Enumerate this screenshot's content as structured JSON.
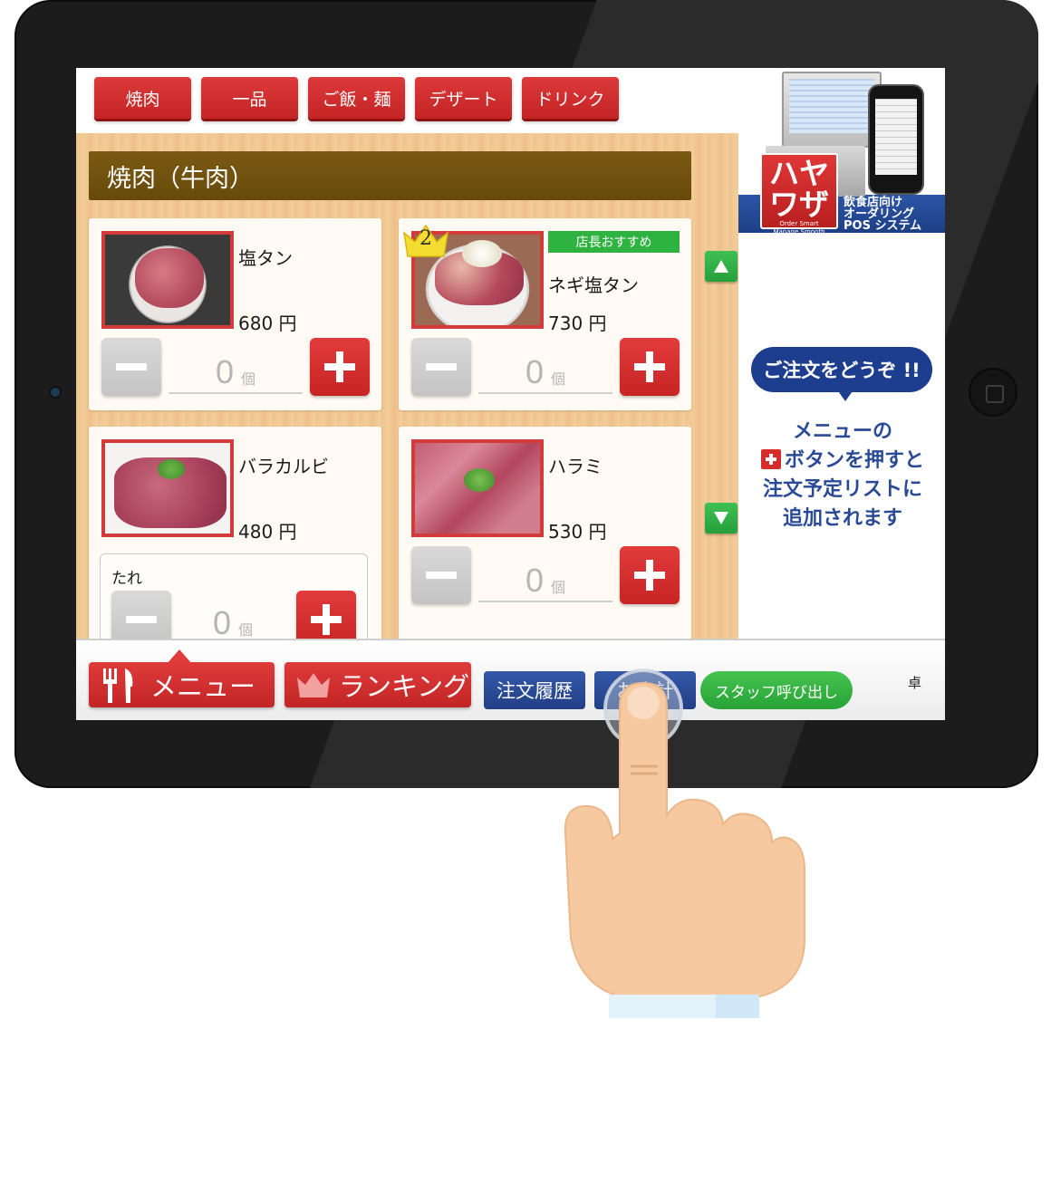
{
  "categories": [
    "焼肉",
    "一品",
    "ご飯・麺",
    "デザート",
    "ドリンク"
  ],
  "section_title": "焼肉（牛肉）",
  "items": [
    {
      "name": "塩タン",
      "price": "680 円",
      "qty": "0",
      "unit": "個"
    },
    {
      "name": "ネギ塩タン",
      "price": "730 円",
      "qty": "0",
      "unit": "個",
      "badge": "店長おすすめ",
      "rank": "2"
    },
    {
      "name": "バラカルビ",
      "price": "480 円",
      "qty": "0",
      "unit": "個",
      "option_label": "たれ"
    },
    {
      "name": "ハラミ",
      "price": "530 円",
      "qty": "0",
      "unit": "個"
    }
  ],
  "ad": {
    "logo_line1": "ハヤ",
    "logo_line2": "ワザ",
    "logo_small1": "Order Smart",
    "logo_small2": "Manage Smooth",
    "tag_line1": "飲食店向け",
    "tag_line2": "オーダリング",
    "tag_line3": "POS システム"
  },
  "prompt": {
    "bubble": "ご注文をどうぞ !!",
    "line1": "メニューの",
    "line2": "ボタンを押すと",
    "line3": "注文予定リストに",
    "line4": "追加されます"
  },
  "bottom": {
    "menu_label": "メニュー",
    "ranking_label": "ランキング",
    "history_label": "注文履歴",
    "checkout_label": "お会計",
    "staff_label": "スタッフ呼び出し",
    "table_label": "卓"
  },
  "colors": {
    "accent_red": "#d33030",
    "accent_green": "#2fb340",
    "accent_blue": "#223f86"
  }
}
